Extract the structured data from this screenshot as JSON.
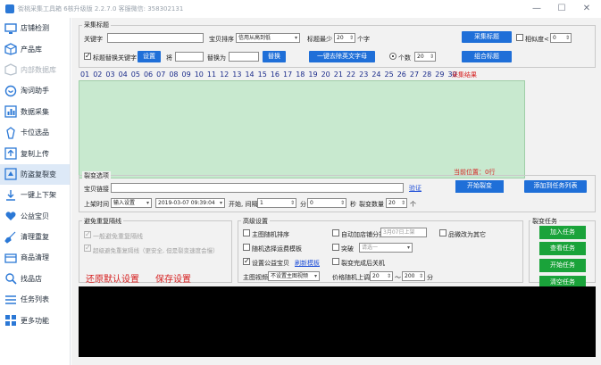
{
  "window": {
    "title": "街桃采集工具箱 6核升级版 2.2.7.0   客服微信: 358302131",
    "min_label": "—",
    "max_label": "☐",
    "close_label": "✕"
  },
  "sidebar": {
    "items": [
      {
        "label": "店铺检测",
        "icon": "monitor-icon"
      },
      {
        "label": "产品库",
        "icon": "box-icon"
      },
      {
        "label": "内部数据库",
        "icon": "database-icon"
      },
      {
        "label": "淘词助手",
        "icon": "word-icon"
      },
      {
        "label": "数据采集",
        "icon": "data-icon"
      },
      {
        "label": "卡位选品",
        "icon": "target-icon"
      },
      {
        "label": "复制上传",
        "icon": "upload-icon"
      },
      {
        "label": "防盗复裂变",
        "icon": "shield-icon"
      },
      {
        "label": "一键上下架",
        "icon": "shelf-icon"
      },
      {
        "label": "公益宝贝",
        "icon": "heart-icon"
      },
      {
        "label": "清理重复",
        "icon": "broom-icon"
      },
      {
        "label": "商品清理",
        "icon": "cart-icon"
      },
      {
        "label": "找品店",
        "icon": "find-icon"
      },
      {
        "label": "任务列表",
        "icon": "list-icon"
      },
      {
        "label": "更多功能",
        "icon": "grid-icon"
      }
    ]
  },
  "collect": {
    "group_title": "采集标题",
    "keyword_label": "关键字",
    "sort_label": "宝贝排序",
    "sort_value": "信用从高到低",
    "min_title_label": "标题最少",
    "min_title_value": "20",
    "chars_label": "个字",
    "collect_btn": "采集标题",
    "similarity_label": "相似度<",
    "similarity_value": "0",
    "replace_keyword_label": "标题替换关键字",
    "settings_btn": "设置",
    "will_label": "将",
    "replace_with_label": "替换为",
    "replace_btn": "替换",
    "remove_english_btn": "一键去除英文字母",
    "count_label": "个数",
    "count_value": "20",
    "combine_btn": "组合标题",
    "results_label": "采集结果",
    "numbers": [
      "01",
      "02",
      "03",
      "04",
      "05",
      "06",
      "07",
      "08",
      "09",
      "10",
      "11",
      "12",
      "13",
      "14",
      "15",
      "16",
      "17",
      "18",
      "19",
      "20",
      "21",
      "22",
      "23",
      "24",
      "25",
      "26",
      "27",
      "28",
      "29",
      "30"
    ]
  },
  "fission": {
    "group_title": "裂变选项",
    "link_label": "宝贝链接",
    "verify_link": "验证",
    "start_btn": "开始裂变",
    "add_task_btn": "添加到任务列表",
    "current_position": "当前位置：0行",
    "time_label": "上架时间",
    "time_mode": "输入设置",
    "datetime": "2019-03-07 09:39:04",
    "start_label": "开始, 间隔",
    "interval_value": "1",
    "minute_label": "分",
    "second_value": "0",
    "second_label": "秒",
    "count_label": "裂变数量",
    "count_value": "20",
    "unit_label": "个"
  },
  "dedupe": {
    "group_title": "避免重复隔线",
    "option1": "一般避免重复隔线",
    "option2": "超级避免重复隔线（更安全, 但是裂变速度会慢）",
    "restore_link": "还原默认设置",
    "save_link": "保存设置"
  },
  "advanced": {
    "group_title": "高级设置",
    "main_image_random": "主图随机排序",
    "auto_category": "自动加店铺分类",
    "category_value": "3月07日上架",
    "ship_other": "品微改为其它",
    "random_shipping": "随机选择运费模板",
    "breakthrough": "突破",
    "select_placeholder": "请选一",
    "set_charity": "设置公益宝贝",
    "refresh_template": "刷新模板",
    "close_after": "裂变完成后关机",
    "main_video_label": "主图视频",
    "main_video_value": "不设置主图视频",
    "price_label": "价格随机上调",
    "price_from": "20",
    "price_to": "200",
    "price_unit": "分"
  },
  "tasks": {
    "group_title": "裂变任务",
    "add_btn": "加入任务",
    "view_btn": "查看任务",
    "start_btn": "开始任务",
    "clear_btn": "清空任务"
  },
  "colors": {
    "accent_blue": "#1f6fd8",
    "green_button": "#1aa33a",
    "results_area": "#c8e9cf",
    "warning_red": "#d62020"
  }
}
